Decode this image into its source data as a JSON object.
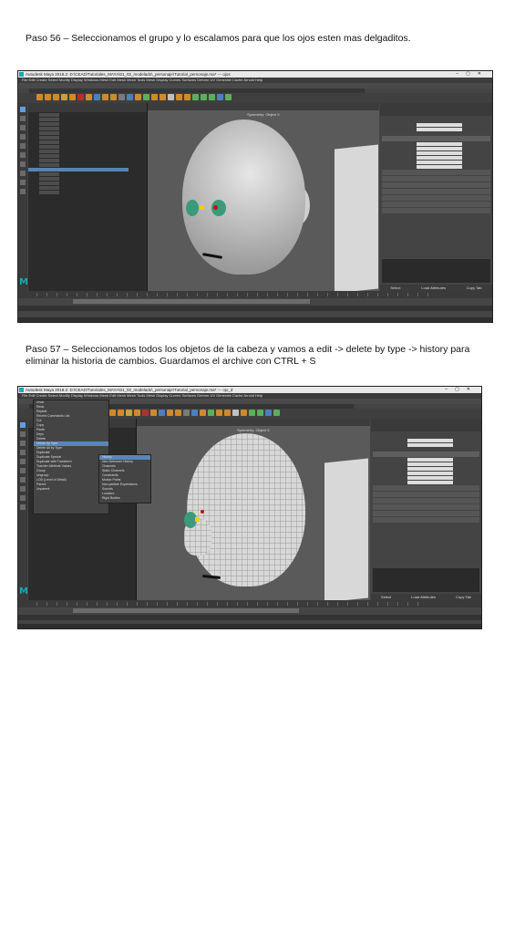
{
  "steps": [
    {
      "text": "Paso 56 – Seleccionamos el grupo y lo escalamos para que los ojos esten mas delgaditos.",
      "screenshot": {
        "app_title": "Autodesk Maya 2018.2: D:\\CEAD\\Tutoriales_MAYA\\01_02_modelado\\_personaje\\Tutorial_personaje.ma*  ---  ojos",
        "menu": "File  Edit  Create  Select  Modify  Display  Windows  Mesh  Edit Mesh  Mesh Tools  Mesh Display  Curves  Surfaces  Deform  UV  Generate  Cache  Arnold  Help",
        "viewport_label": "Symmetry: Object X",
        "attr_buttons": [
          "Select",
          "Load Attributes",
          "Copy Tab"
        ]
      }
    },
    {
      "text": "Paso 57 – Seleccionamos todos los objetos de la cabeza y vamos a edit -> delete by type -> history para eliminar la historia de cambios. Guardamos el archive con CTRL + S",
      "screenshot": {
        "app_title": "Autodesk Maya 2018.2: D:\\CEAD\\Tutoriales_MAYA\\01_02_modelado\\_personaje\\Tutorial_personaje.ma*  ---  ojo_d",
        "menu": "File  Edit  Create  Select  Modify  Display  Windows  Mesh  Edit Mesh  Mesh Tools  Mesh Display  Curves  Surfaces  Deform  UV  Generate  Cache  Arnold  Help",
        "viewport_label": "Symmetry: Object X",
        "edit_menu": [
          "Undo",
          "Redo",
          "Repeat",
          "Recent Commands List",
          "Cut",
          "Copy",
          "Paste",
          "Keys",
          "Delete",
          "Delete by Type",
          "Delete All by Type",
          "Duplicate",
          "Duplicate Special",
          "Duplicate with Transform",
          "Transfer Attribute Values",
          "Group",
          "Ungroup",
          "LOD (Level of Detail)",
          "Parent",
          "Unparent"
        ],
        "submenu": [
          "History",
          "Non-Deformer History",
          "Channels",
          "Static Channels",
          "Constraints",
          "Motion Paths",
          "Non-particle Expressions",
          "Sounds",
          "Locators",
          "Rigid Bodies"
        ],
        "attr_buttons": [
          "Select",
          "Load Attributes",
          "Copy Tab"
        ]
      }
    }
  ],
  "colors": {
    "maya_teal": "#1aa7b8",
    "selection_blue": "#5a85b8",
    "shelf_orange": "#d08a2a"
  }
}
